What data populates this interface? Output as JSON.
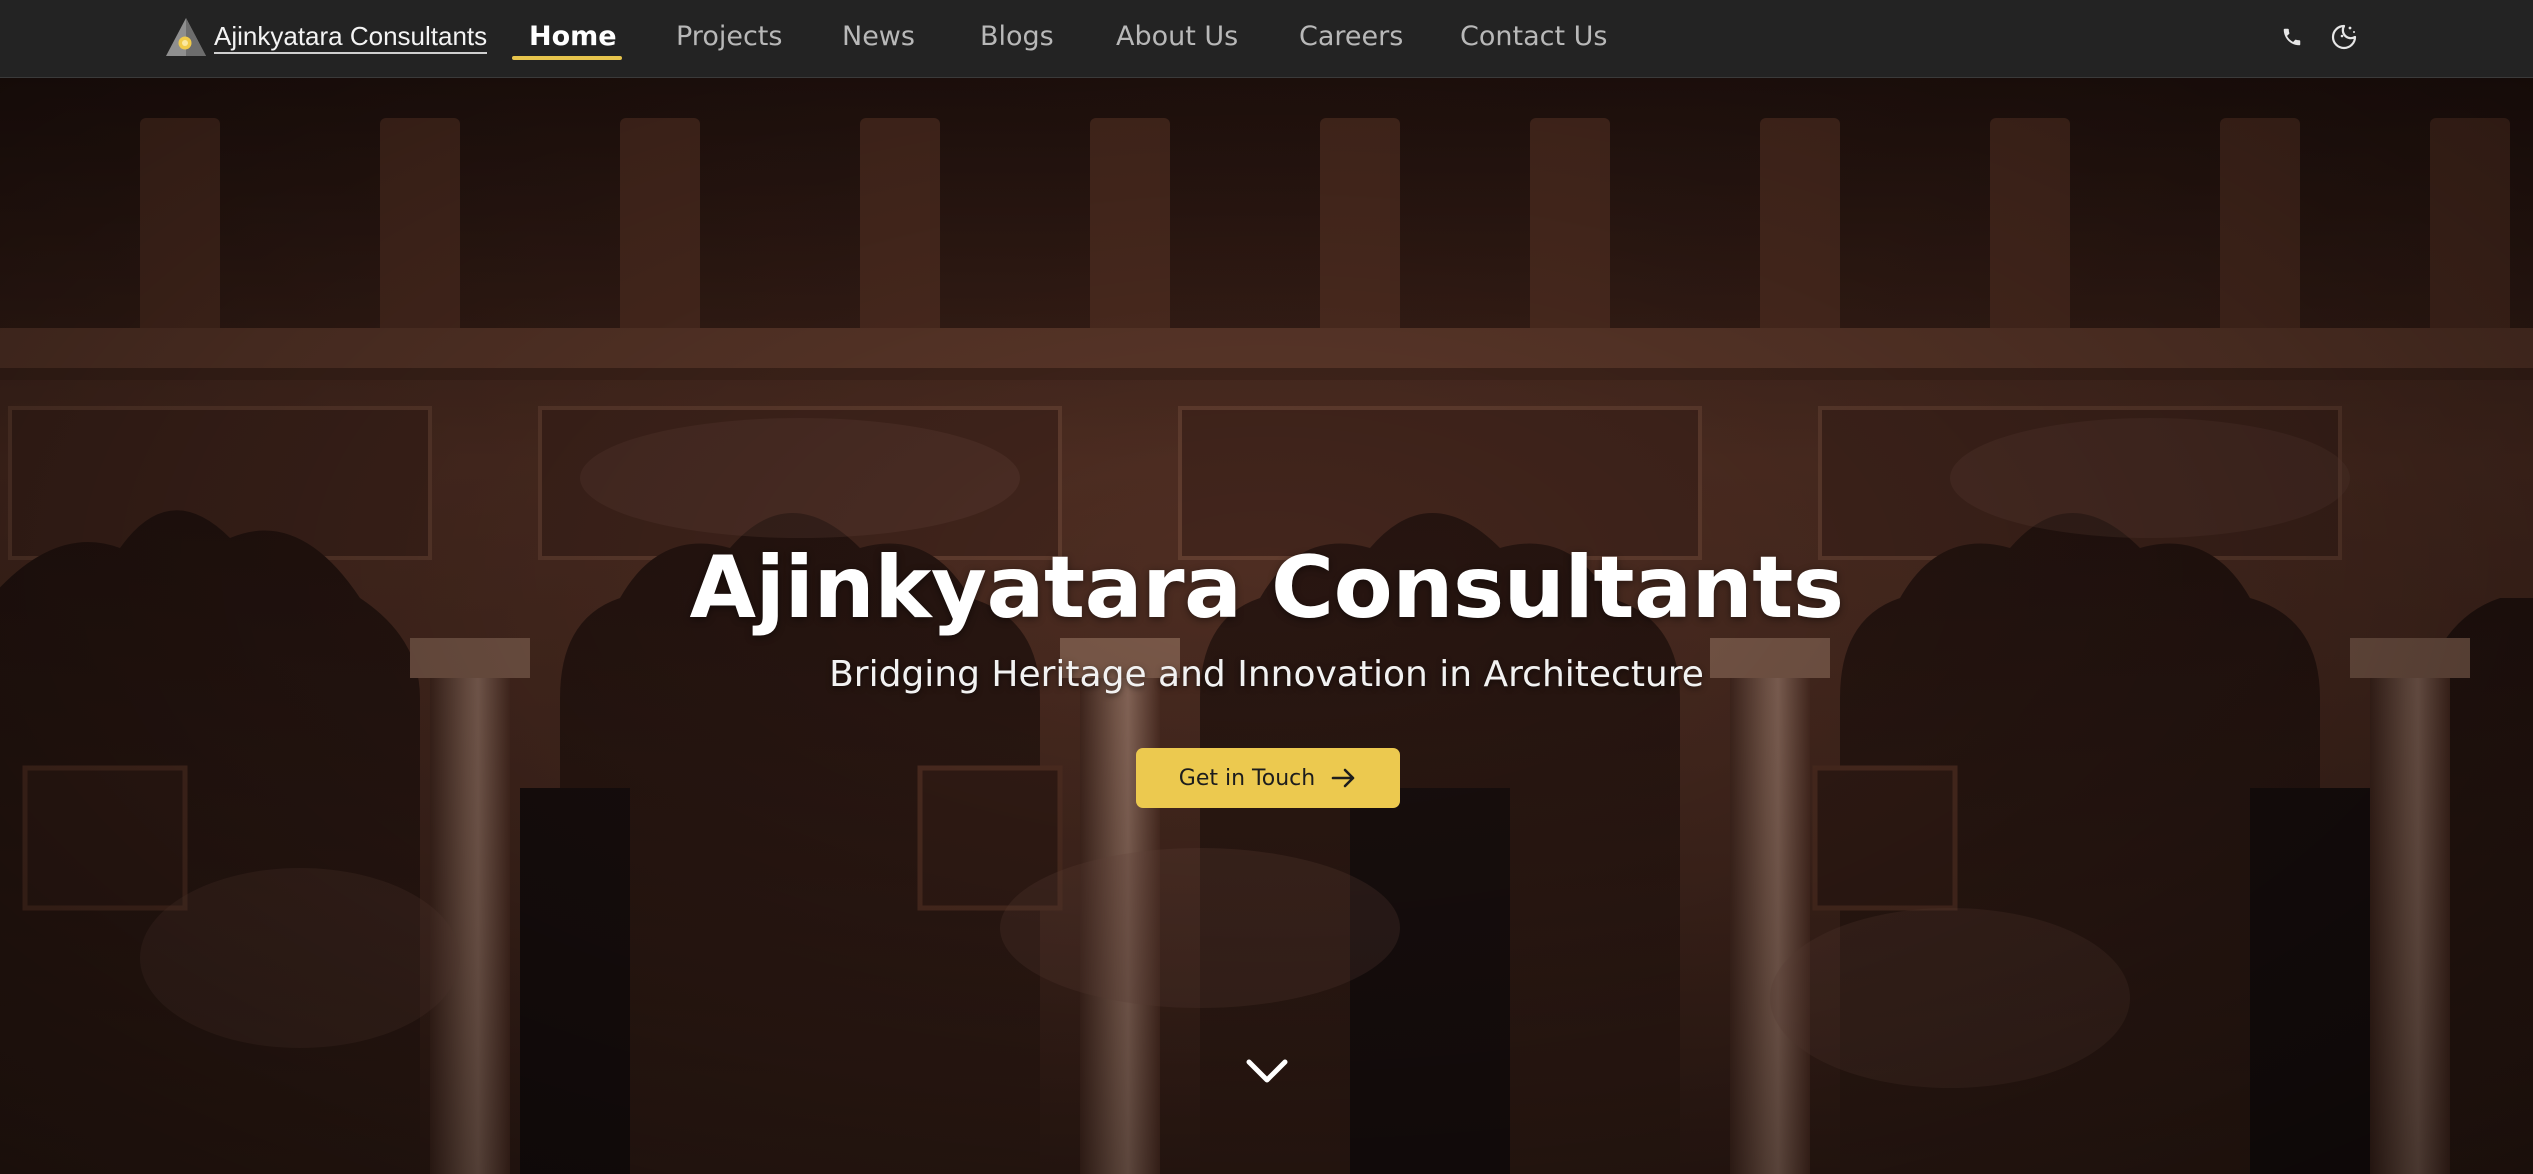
{
  "brand": {
    "name": "Ajinkyatara Consultants",
    "logo_icon": "triangle-sun-logo"
  },
  "nav": {
    "items": [
      {
        "label": "Home",
        "active": true
      },
      {
        "label": "Projects",
        "active": false
      },
      {
        "label": "News",
        "active": false
      },
      {
        "label": "Blogs",
        "active": false
      },
      {
        "label": "About Us",
        "active": false
      },
      {
        "label": "Careers",
        "active": false
      },
      {
        "label": "Contact Us",
        "active": false
      }
    ],
    "icons": [
      "phone-icon",
      "theme-toggle-icon"
    ]
  },
  "hero": {
    "title": "Ajinkyatara Consultants",
    "subtitle": "Bridging Heritage and Innovation in Architecture",
    "cta_label": "Get in Touch",
    "cta_icon": "arrow-right-icon",
    "scroll_icon": "chevron-down-icon",
    "background": "heritage-arched-colonnade-photo"
  },
  "colors": {
    "nav_bg": "#232323",
    "accent": "#ecc94f",
    "underline": "#e6c44c",
    "text_primary": "#ffffff",
    "text_muted": "#b8b8b8"
  }
}
